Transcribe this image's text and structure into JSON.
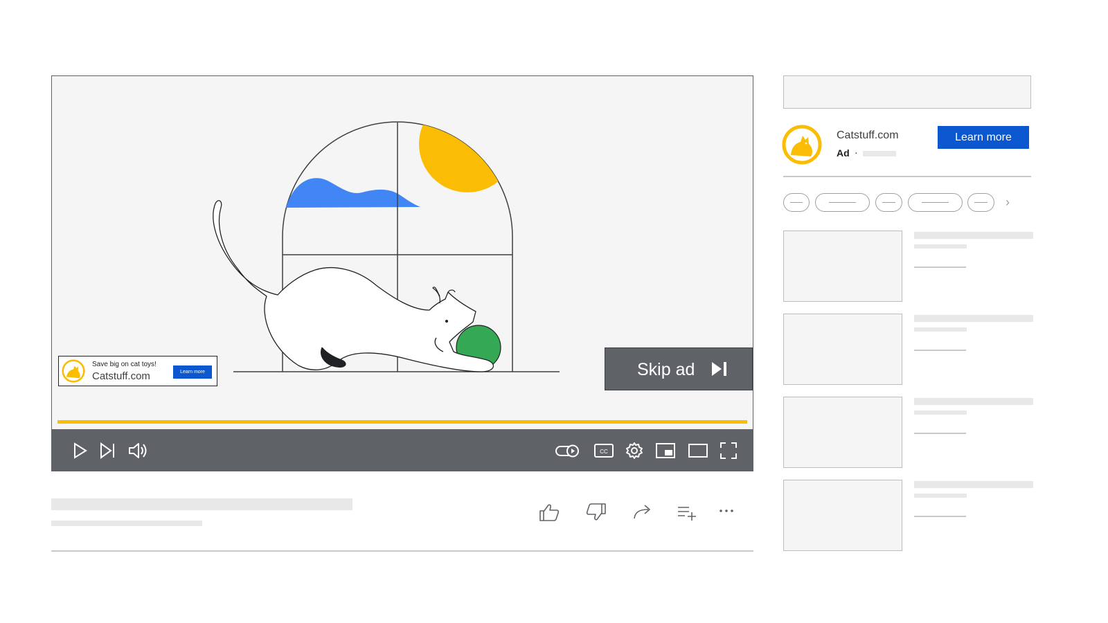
{
  "video": {
    "skip_ad_label": "Skip ad",
    "progress_percent": 100,
    "overlay_ad": {
      "promo_text": "Save big on cat toys!",
      "site": "Catstuff.com",
      "button_label": "Learn more"
    },
    "controls": {
      "left": [
        "play-icon",
        "next-icon",
        "volume-icon"
      ],
      "right": [
        "autoplay-toggle-icon",
        "captions-icon",
        "settings-icon",
        "miniplayer-icon",
        "theater-mode-icon",
        "fullscreen-icon"
      ]
    }
  },
  "actions": [
    "like-icon",
    "dislike-icon",
    "share-icon",
    "save-to-playlist-icon",
    "more-icon"
  ],
  "sidebar": {
    "ad": {
      "site": "Catstuff.com",
      "tag": "Ad",
      "separator": "·",
      "button_label": "Learn more"
    },
    "chips_next": "›"
  },
  "colors": {
    "brand_yellow": "#fbbc04",
    "button_blue": "#0b57d0",
    "control_bar": "#5f6368",
    "cloud_blue": "#4285f4",
    "ball_green": "#34a853"
  }
}
